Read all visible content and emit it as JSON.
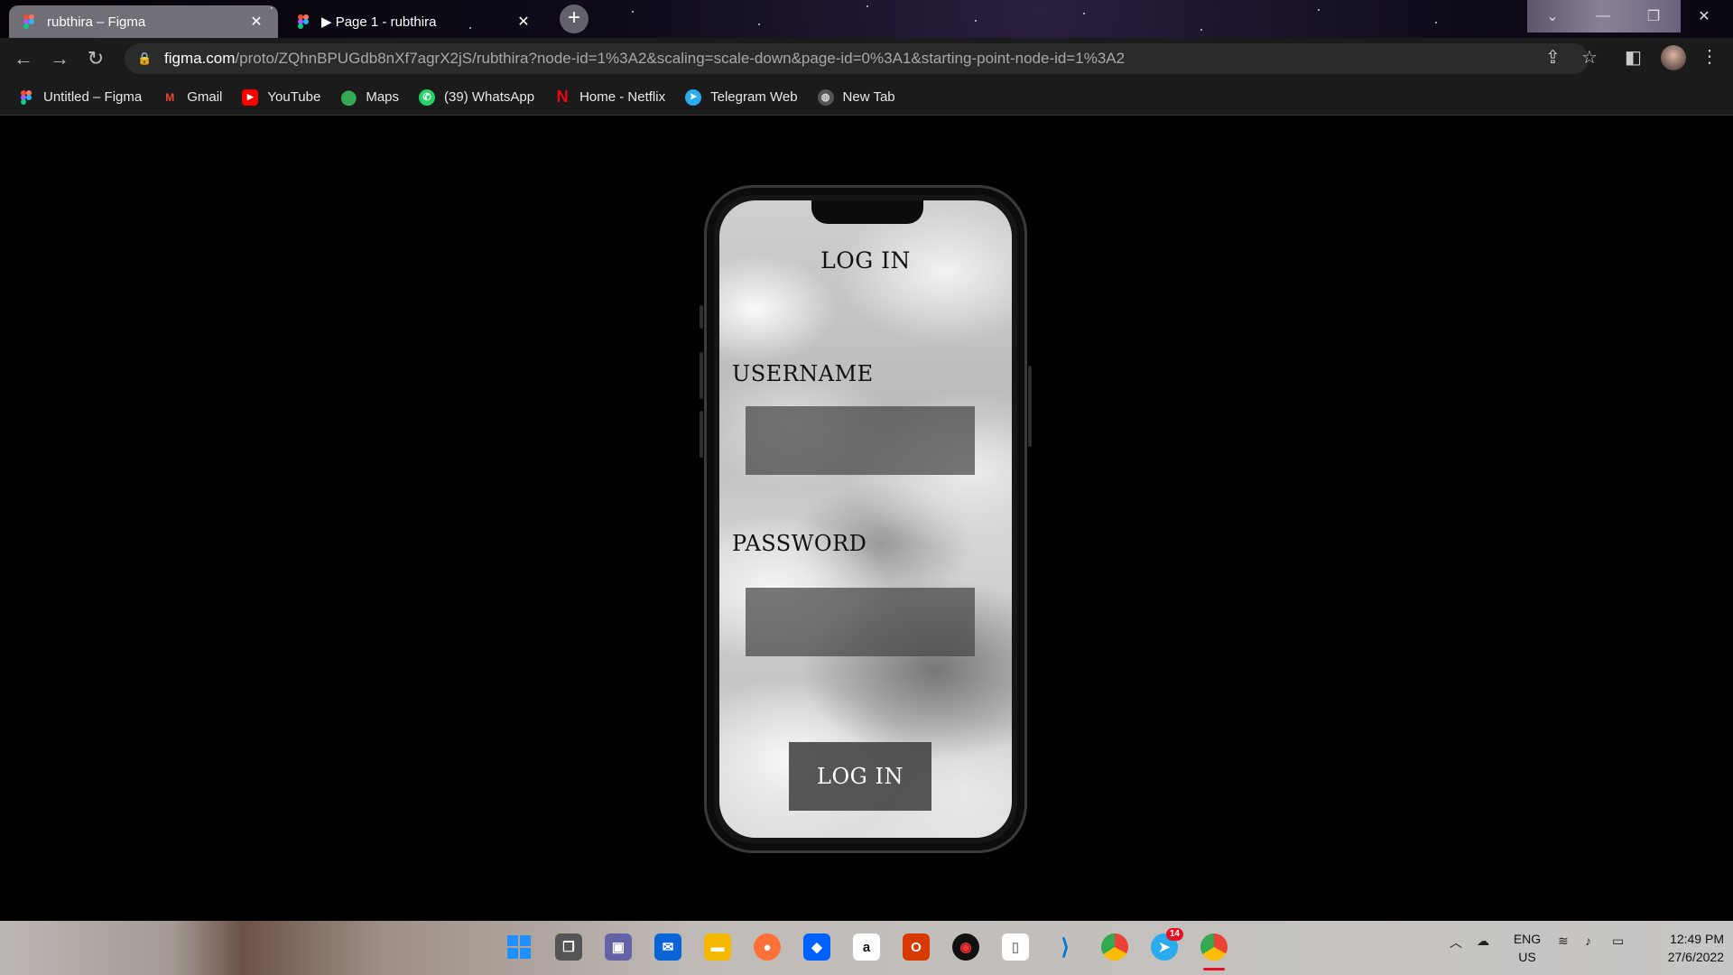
{
  "browser": {
    "tabs": [
      {
        "label": "rubthira – Figma",
        "active": true
      },
      {
        "label": "▶ Page 1 - rubthira",
        "active": false
      }
    ],
    "new_tab_symbol": "+",
    "close_symbol": "✕",
    "url_domain": "figma.com",
    "url_path": "/proto/ZQhnBPUGdb8nXf7agrX2jS/rubthira?node-id=1%3A2&scaling=scale-down&page-id=0%3A1&starting-point-node-id=1%3A2",
    "bookmarks": [
      {
        "label": "Untitled – Figma",
        "icon": "figma-icon"
      },
      {
        "label": "Gmail",
        "icon": "gmail-icon"
      },
      {
        "label": "YouTube",
        "icon": "youtube-icon"
      },
      {
        "label": "Maps",
        "icon": "maps-icon"
      },
      {
        "label": "(39) WhatsApp",
        "icon": "whatsapp-icon"
      },
      {
        "label": "Home - Netflix",
        "icon": "netflix-icon"
      },
      {
        "label": "Telegram Web",
        "icon": "telegram-icon"
      },
      {
        "label": "New Tab",
        "icon": "globe-icon"
      }
    ]
  },
  "app": {
    "title": "LOG IN",
    "username_label": "USERNAME",
    "password_label": "PASSWORD",
    "button_label": "LOG IN"
  },
  "taskbar": {
    "telegram_badge": "14",
    "language": "ENG",
    "region": "US",
    "time": "12:49 PM",
    "date": "27/6/2022"
  },
  "colors": {
    "page_bg": "#000000",
    "input_bg": "#4a4a4a",
    "button_bg": "#414141",
    "text_dark": "#111111"
  }
}
